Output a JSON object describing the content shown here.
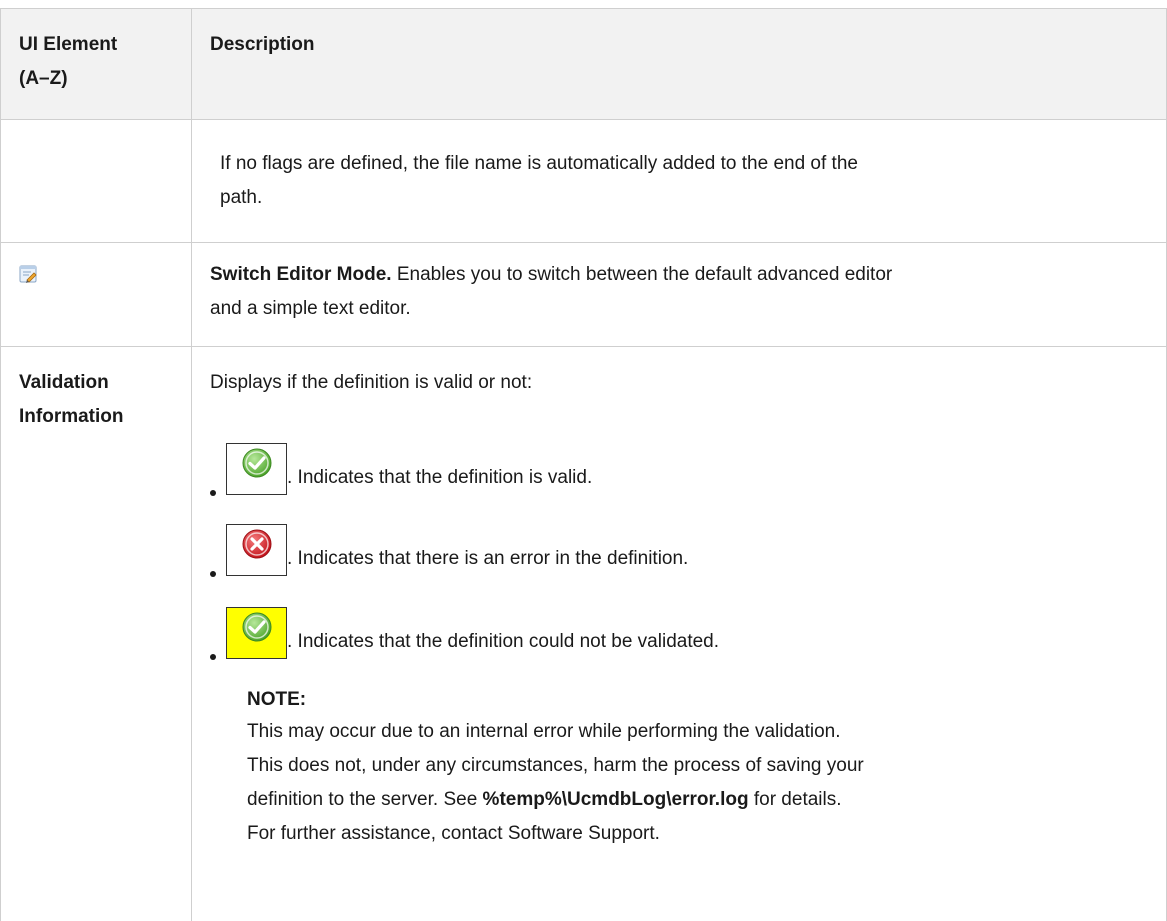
{
  "header": {
    "col1_line1": "UI Element",
    "col1_line2": "(A–Z)",
    "col2": "Description"
  },
  "rows": [
    {
      "element": "",
      "description_line1": "If no flags are defined, the file name is automatically added to the end of the",
      "description_line2": "path."
    },
    {
      "element_icon": "switch-editor-mode-icon",
      "title": "Switch Editor Mode.",
      "description_line1_rest": " Enables you to switch between the default advanced editor",
      "description_line2": "and a simple text editor."
    },
    {
      "element_line1": "Validation",
      "element_line2": "Information",
      "intro": "Displays if the definition is valid or not:",
      "bullets": [
        {
          "icon": "valid-check-icon",
          "text": ". Indicates that the definition is valid."
        },
        {
          "icon": "error-x-icon",
          "text": ". Indicates that there is an error in the definition."
        },
        {
          "icon": "not-validated-check-icon",
          "text": ". Indicates that the definition could not be validated."
        }
      ],
      "note": {
        "label": "NOTE:",
        "line1": "This may occur due to an internal error while performing the validation.",
        "line2": "This does not, under any circumstances, harm the process of saving your",
        "line3_pre": "definition to the server. See ",
        "line3_bold": "%temp%\\UcmdbLog\\error.log",
        "line3_post": " for details.",
        "line4": "For further assistance, contact Software Support."
      }
    }
  ],
  "colors": {
    "border": "#cfcfcf",
    "header_bg": "#f2f2f2",
    "valid_green": "#6cc24a",
    "error_red": "#d9262c",
    "highlight_yellow": "#ffff00"
  }
}
